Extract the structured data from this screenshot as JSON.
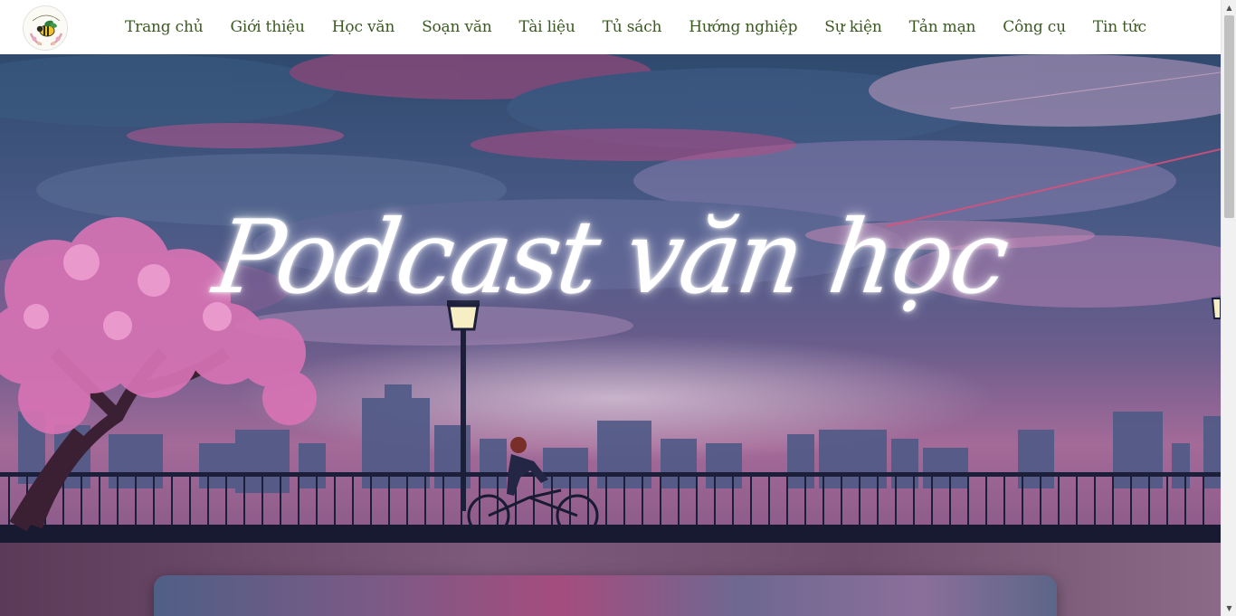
{
  "header": {
    "logo": {
      "text": "Catalyst Literature"
    },
    "nav": [
      {
        "label": "Trang chủ"
      },
      {
        "label": "Giới thiệu"
      },
      {
        "label": "Học văn"
      },
      {
        "label": "Soạn văn"
      },
      {
        "label": "Tài liệu"
      },
      {
        "label": "Tủ sách"
      },
      {
        "label": "Hướng nghiệp"
      },
      {
        "label": "Sự kiện"
      },
      {
        "label": "Tản mạn"
      },
      {
        "label": "Công cụ"
      },
      {
        "label": "Tin tức"
      }
    ]
  },
  "hero": {
    "title": "Podcast văn học"
  },
  "colors": {
    "nav_text": "#3a5a1f",
    "sky_top": "#2f4a6e",
    "sky_mid": "#6a5d8c",
    "horizon": "#a46a98",
    "blossom": "#d773b4",
    "railing": "#1c1f3a"
  },
  "icons": {
    "scroll_up": "▲",
    "scroll_down": "▼"
  }
}
